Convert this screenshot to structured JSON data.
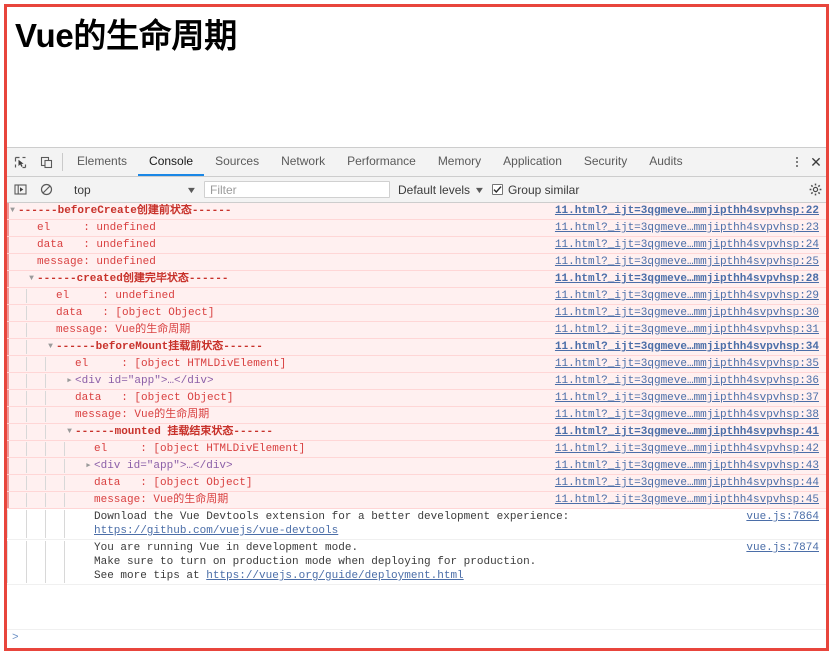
{
  "page": {
    "title": "Vue的生命周期"
  },
  "devtools": {
    "tabs": [
      {
        "label": "Elements",
        "active": false
      },
      {
        "label": "Console",
        "active": true
      },
      {
        "label": "Sources",
        "active": false
      },
      {
        "label": "Network",
        "active": false
      },
      {
        "label": "Performance",
        "active": false
      },
      {
        "label": "Memory",
        "active": false
      },
      {
        "label": "Application",
        "active": false
      },
      {
        "label": "Security",
        "active": false
      },
      {
        "label": "Audits",
        "active": false
      }
    ],
    "close_label": "✕",
    "filterbar": {
      "context": "top",
      "context_caret": "▼",
      "filter_placeholder": "Filter",
      "filter_value": "",
      "levels_label": "Default levels",
      "levels_caret": "▼",
      "group_similar_label": "Group similar",
      "group_similar_checked": true
    },
    "prompt": ">"
  },
  "console": {
    "rows": [
      {
        "indent": 0,
        "arrow": "down",
        "style": "err",
        "text_style": "redb",
        "text": "------beforeCreate创建前状态------",
        "source": "11.html?_ijt=3qgmeve…mmjipthh4svpvhsp:22",
        "source_bold": true
      },
      {
        "indent": 1,
        "arrow": "blank",
        "style": "err",
        "text_style": "red",
        "text": "el     : undefined",
        "source": "11.html?_ijt=3qgmeve…mmjipthh4svpvhsp:23",
        "source_bold": false
      },
      {
        "indent": 1,
        "arrow": "blank",
        "style": "err",
        "text_style": "red",
        "text": "data   : undefined",
        "source": "11.html?_ijt=3qgmeve…mmjipthh4svpvhsp:24",
        "source_bold": false
      },
      {
        "indent": 1,
        "arrow": "blank",
        "style": "err",
        "text_style": "red",
        "text": "message: undefined",
        "source": "11.html?_ijt=3qgmeve…mmjipthh4svpvhsp:25",
        "source_bold": false
      },
      {
        "indent": 1,
        "arrow": "down",
        "style": "err",
        "text_style": "redb",
        "text": "------created创建完毕状态------",
        "source": "11.html?_ijt=3qgmeve…mmjipthh4svpvhsp:28",
        "source_bold": true
      },
      {
        "indent": 2,
        "arrow": "blank",
        "style": "err",
        "text_style": "red",
        "text": "el     : undefined",
        "source": "11.html?_ijt=3qgmeve…mmjipthh4svpvhsp:29",
        "source_bold": false
      },
      {
        "indent": 2,
        "arrow": "blank",
        "style": "err",
        "text_style": "red",
        "text": "data   : [object Object]",
        "source": "11.html?_ijt=3qgmeve…mmjipthh4svpvhsp:30",
        "source_bold": false
      },
      {
        "indent": 2,
        "arrow": "blank",
        "style": "err",
        "text_style": "red",
        "text": "message: Vue的生命周期",
        "source": "11.html?_ijt=3qgmeve…mmjipthh4svpvhsp:31",
        "source_bold": false
      },
      {
        "indent": 2,
        "arrow": "down",
        "style": "err",
        "text_style": "redb",
        "text": "------beforeMount挂载前状态------",
        "source": "11.html?_ijt=3qgmeve…mmjipthh4svpvhsp:34",
        "source_bold": true
      },
      {
        "indent": 3,
        "arrow": "blank",
        "style": "err",
        "text_style": "red",
        "text": "el     : [object HTMLDivElement]",
        "source": "11.html?_ijt=3qgmeve…mmjipthh4svpvhsp:35",
        "source_bold": false
      },
      {
        "indent": 3,
        "arrow": "right",
        "style": "err",
        "text_style": "node",
        "text": "<div id=\"app\">…</div>",
        "source": "11.html?_ijt=3qgmeve…mmjipthh4svpvhsp:36",
        "source_bold": false
      },
      {
        "indent": 3,
        "arrow": "blank",
        "style": "err",
        "text_style": "red",
        "text": "data   : [object Object]",
        "source": "11.html?_ijt=3qgmeve…mmjipthh4svpvhsp:37",
        "source_bold": false
      },
      {
        "indent": 3,
        "arrow": "blank",
        "style": "err",
        "text_style": "red",
        "text": "message: Vue的生命周期",
        "source": "11.html?_ijt=3qgmeve…mmjipthh4svpvhsp:38",
        "source_bold": false
      },
      {
        "indent": 3,
        "arrow": "down",
        "style": "err",
        "text_style": "redb",
        "text": "------mounted 挂载结束状态------",
        "source": "11.html?_ijt=3qgmeve…mmjipthh4svpvhsp:41",
        "source_bold": true
      },
      {
        "indent": 4,
        "arrow": "blank",
        "style": "err",
        "text_style": "red",
        "text": "el     : [object HTMLDivElement]",
        "source": "11.html?_ijt=3qgmeve…mmjipthh4svpvhsp:42",
        "source_bold": false
      },
      {
        "indent": 4,
        "arrow": "right",
        "style": "err",
        "text_style": "node",
        "text": "<div id=\"app\">…</div>",
        "source": "11.html?_ijt=3qgmeve…mmjipthh4svpvhsp:43",
        "source_bold": false
      },
      {
        "indent": 4,
        "arrow": "blank",
        "style": "err",
        "text_style": "red",
        "text": "data   : [object Object]",
        "source": "11.html?_ijt=3qgmeve…mmjipthh4svpvhsp:44",
        "source_bold": false
      },
      {
        "indent": 4,
        "arrow": "blank",
        "style": "err",
        "text_style": "red",
        "text": "message: Vue的生命周期",
        "source": "11.html?_ijt=3qgmeve…mmjipthh4svpvhsp:45",
        "source_bold": false
      }
    ],
    "devtools_notice": {
      "indent": 4,
      "line1": "Download the Vue Devtools extension for a better development experience:",
      "link": "https://github.com/vuejs/vue-devtools",
      "source": "vue.js:7864"
    },
    "devmode_notice": {
      "indent": 4,
      "line1": "You are running Vue in development mode.",
      "line2": "Make sure to turn on production mode when deploying for production.",
      "line3_prefix": "See more tips at ",
      "line3_link": "https://vuejs.org/guide/deployment.html",
      "source": "vue.js:7874"
    }
  }
}
